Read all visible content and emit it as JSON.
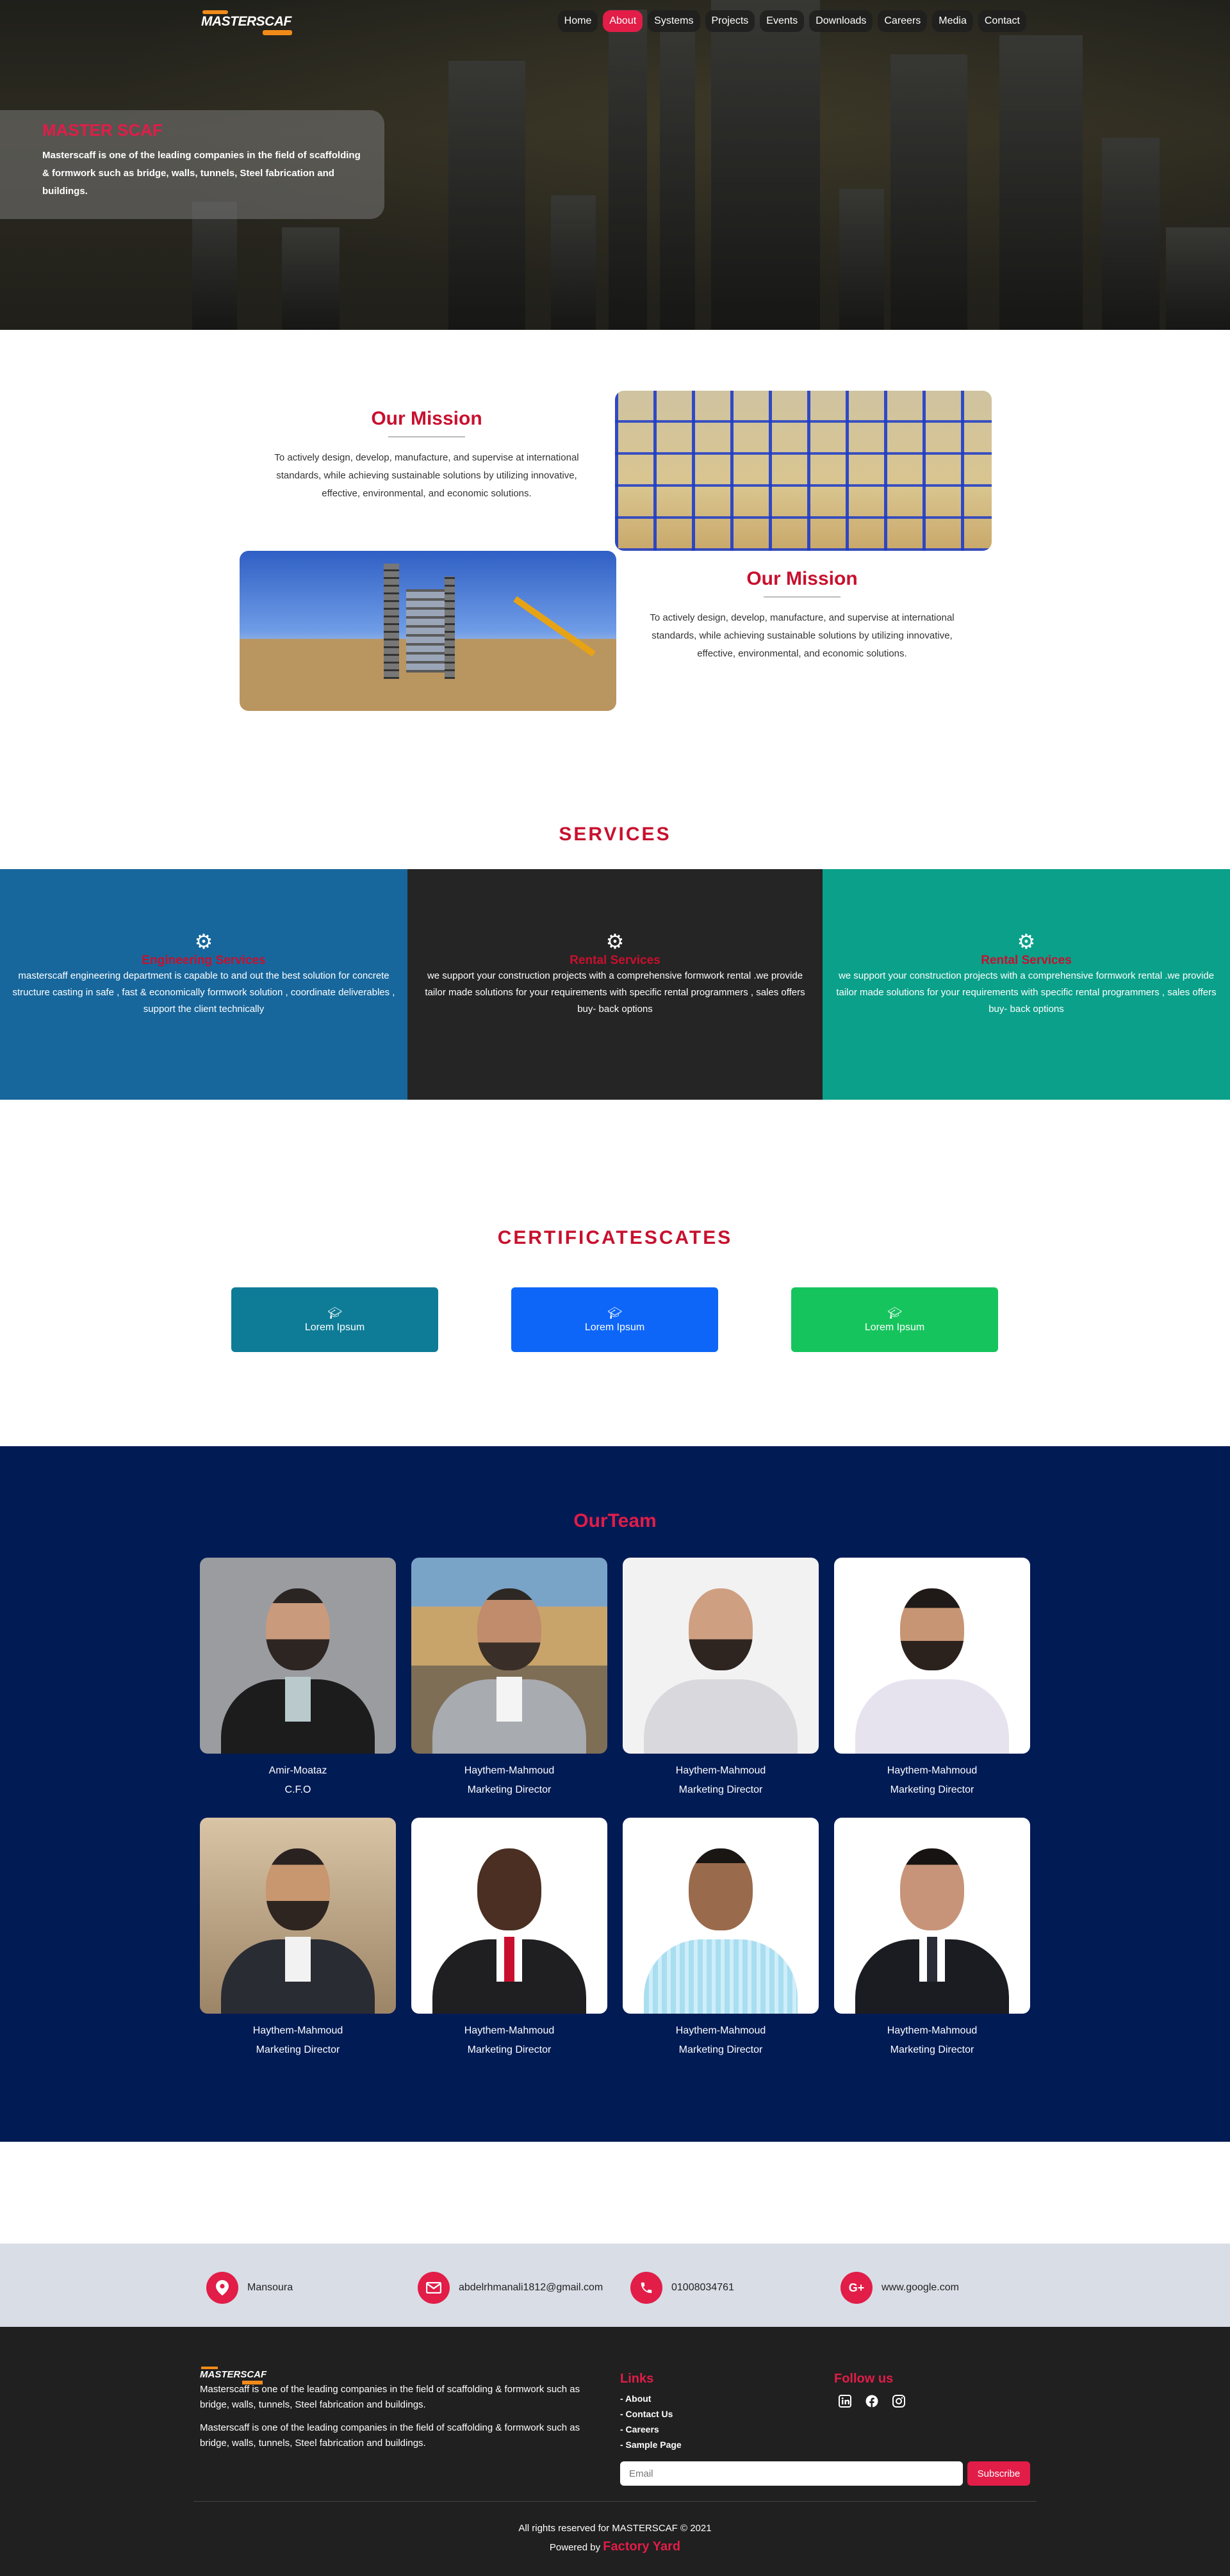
{
  "nav": {
    "logo_text": "MASTERSCAF",
    "items": [
      "Home",
      "About",
      "Systems",
      "Projects",
      "Events",
      "Downloads",
      "Careers",
      "Media",
      "Contact"
    ],
    "active": "About"
  },
  "hero": {
    "title": "MASTER SCAF",
    "text": "Masterscaff is one of the leading companies in the field of scaffolding & formwork such as bridge, walls, tunnels, Steel fabrication and buildings."
  },
  "mission": [
    {
      "title": "Our Mission",
      "text": "To actively design, develop, manufacture, and supervise at international standards, while achieving sustainable solutions by utilizing innovative, effective, environmental, and economic solutions."
    },
    {
      "title": "Our Mission",
      "text": "To actively design, develop, manufacture, and supervise at international standards, while achieving sustainable solutions by utilizing innovative, effective, environmental, and economic solutions."
    }
  ],
  "services": {
    "title": "SERVICES",
    "items": [
      {
        "title": "Engineering Services",
        "text": "masterscaff engineering department is capable to and out the best solution for concrete structure casting in safe , fast & economically formwork solution , coordinate deliverables , support the client technically",
        "color": "#17679c"
      },
      {
        "title": "Rental Services",
        "text": "we support your construction projects with a comprehensive formwork rental .we provide tailor made solutions for your requirements with specific rental programmers , sales offers buy- back options",
        "color": "#252525"
      },
      {
        "title": "Rental Services",
        "text": "we support your construction projects with a comprehensive formwork rental .we provide tailor made solutions for your requirements with specific rental programmers , sales offers buy- back options",
        "color": "#0ba08a"
      }
    ]
  },
  "certificates": {
    "title": "CERTIFICATESCATES",
    "items": [
      {
        "label": "Lorem Ipsum",
        "color": "#0e7c97"
      },
      {
        "label": "Lorem Ipsum",
        "color": "#0d66f7"
      },
      {
        "label": "Lorem Ipsum",
        "color": "#16c45d"
      }
    ]
  },
  "team": {
    "title": "OurTeam",
    "members": [
      {
        "name": "Amir-Moataz",
        "role": "C.F.O"
      },
      {
        "name": "Haythem-Mahmoud",
        "role": "Marketing Director"
      },
      {
        "name": "Haythem-Mahmoud",
        "role": "Marketing Director"
      },
      {
        "name": "Haythem-Mahmoud",
        "role": "Marketing Director"
      },
      {
        "name": "Haythem-Mahmoud",
        "role": "Marketing Director"
      },
      {
        "name": "Haythem-Mahmoud",
        "role": "Marketing Director"
      },
      {
        "name": "Haythem-Mahmoud",
        "role": "Marketing Director"
      },
      {
        "name": "Haythem-Mahmoud",
        "role": "Marketing Director"
      }
    ]
  },
  "contact": {
    "location": "Mansoura",
    "email": "abdelrhmanali1812@gmail.com",
    "phone": "01008034761",
    "website": "www.google.com"
  },
  "footer": {
    "logo_text": "MASTERSCAF",
    "about_1": "Masterscaff is one of the leading companies in the field of scaffolding & formwork such as bridge, walls, tunnels, Steel fabrication and buildings.",
    "about_2": "Masterscaff is one of the leading companies in the field of scaffolding & formwork such as bridge, walls, tunnels, Steel fabrication and buildings.",
    "links_title": "Links",
    "links": [
      "- About",
      "- Contact Us",
      "- Careers",
      "- Sample Page"
    ],
    "follow_title": "Follow us",
    "email_placeholder": "Email",
    "subscribe": "Subscribe",
    "copyright": "All rights reserved for MASTERSCAF © 2021",
    "powered_prefix": "Powered by",
    "powered_brand": "Factory Yard"
  },
  "colors": {
    "accent": "#e11d48",
    "team_bg": "#011b55",
    "footer_bg": "#202020",
    "contact_bg": "#d8dde6"
  },
  "icons": {
    "service": "gear-icon",
    "certificate": "graduation-cap-icon",
    "location": "map-pin-icon",
    "email": "envelope-icon",
    "phone": "phone-icon",
    "website": "google-plus-icon",
    "social": [
      "linkedin-icon",
      "facebook-icon",
      "instagram-icon"
    ]
  }
}
